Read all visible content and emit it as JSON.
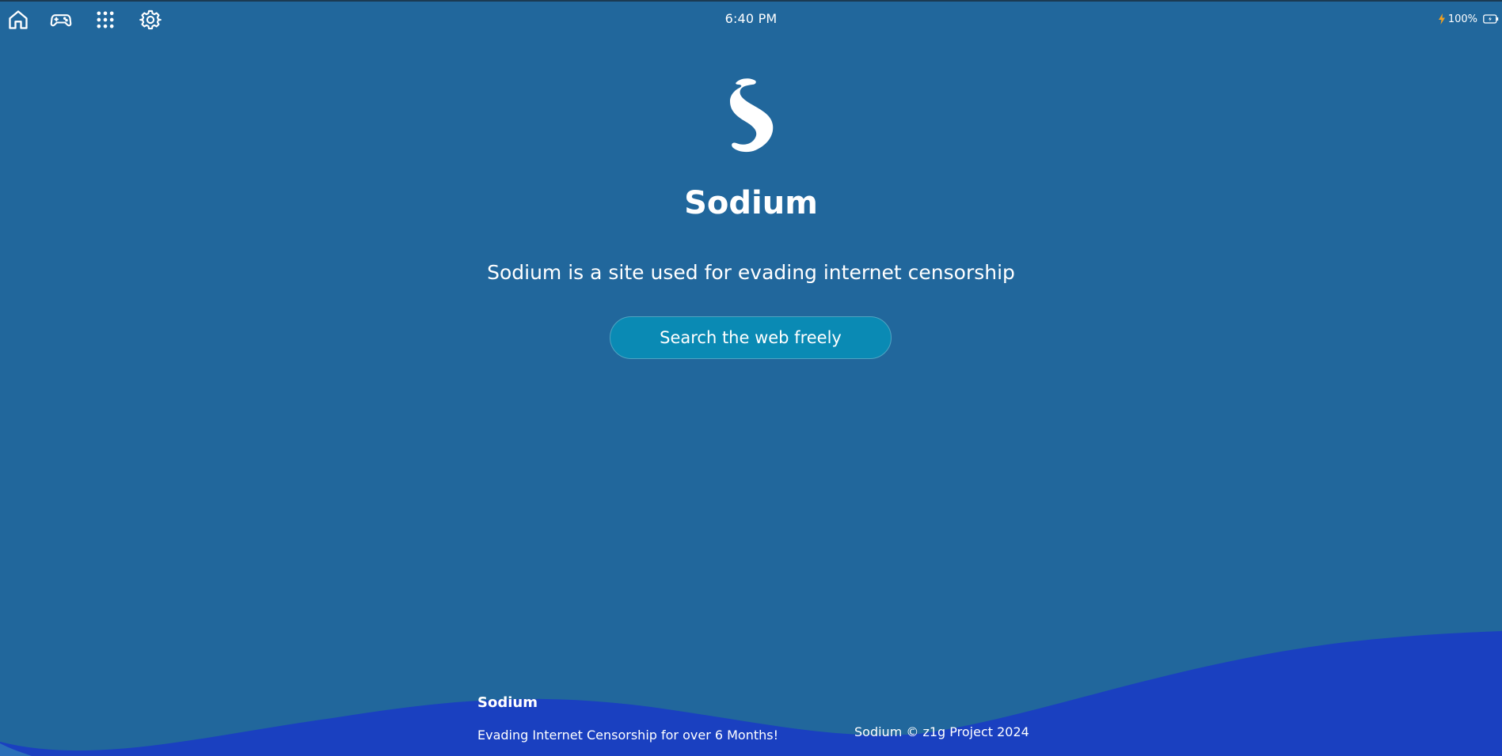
{
  "topbar": {
    "icons": [
      "home-icon",
      "gamepad-icon",
      "apps-grid-icon",
      "gear-icon"
    ],
    "clock": "6:40 PM",
    "battery_level": "100%",
    "charging_color": "#f0a020"
  },
  "hero": {
    "logo": "sodium-s-logo",
    "title": "Sodium",
    "subtitle": "Sodium is a site used for evading internet censorship",
    "cta_label": "Search the web freely"
  },
  "footer": {
    "brand": "Sodium",
    "tagline": "Evading Internet Censorship for over 6 Months!",
    "copyright": "Sodium © z1g Project 2024"
  },
  "colors": {
    "background": "#21679c",
    "wave": "#1a40c0",
    "button": "#0a8ab4",
    "text": "#ffffff"
  }
}
